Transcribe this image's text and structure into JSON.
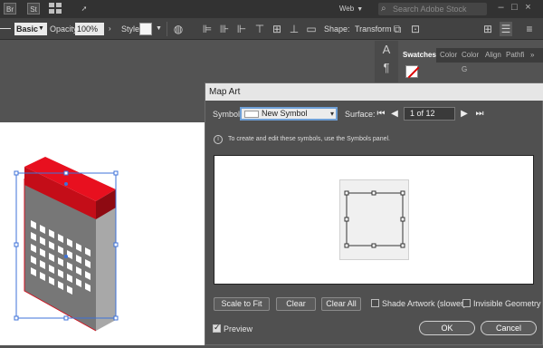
{
  "app_bar": {
    "bridge_label": "Br",
    "stock_label": "St",
    "workspace": "Web",
    "search_placeholder": "Search Adobe Stock"
  },
  "control_bar": {
    "brush": "Basic",
    "opacity_label": "Opacity:",
    "opacity_value": "100%",
    "style_label": "Style:",
    "shape_label": "Shape:",
    "transform_label": "Transform"
  },
  "panel": {
    "tabs": [
      "Swatches",
      "Color",
      "Color G",
      "Align",
      "Pathfi"
    ]
  },
  "dialog": {
    "title": "Map Art",
    "symbol_label": "Symbol:",
    "symbol_value": "New Symbol",
    "surface_label": "Surface:",
    "surface_page": "1 of 12",
    "info_text": "To create and edit these symbols, use the Symbols panel.",
    "scale_button": "Scale to Fit",
    "clear_button": "Clear",
    "clear_all_button": "Clear All",
    "shade_label": "Shade Artwork (slower)",
    "invisible_label": "Invisible Geometry",
    "preview_label": "Preview",
    "ok_label": "OK",
    "cancel_label": "Cancel"
  },
  "colors": {
    "workspace_bg": "#535353",
    "dialog_bg": "#505050",
    "selection_blue": "#3d72d8",
    "object_red": "#d0121f",
    "object_gray": "#7a7a7a",
    "highlight_blue": "#6e9fd6"
  },
  "state": {
    "preview_checked": true,
    "shade_checked": false,
    "invisible_checked": false
  }
}
